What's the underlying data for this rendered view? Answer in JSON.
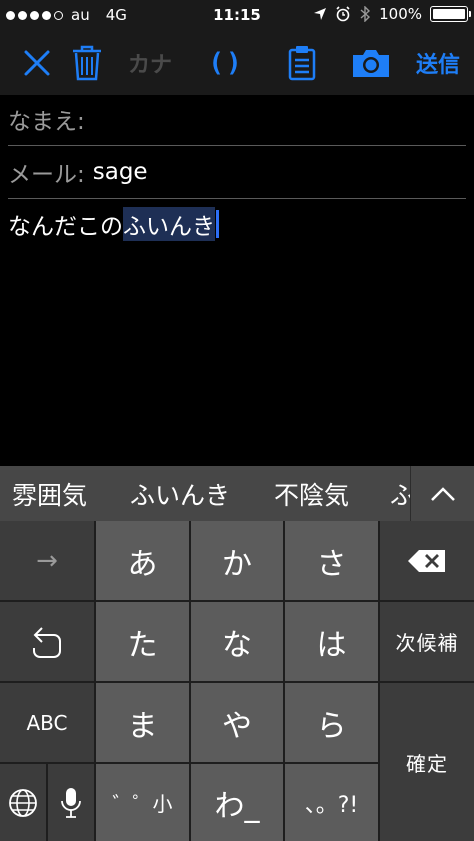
{
  "status_bar": {
    "carrier": "au",
    "network": "4G",
    "time": "11:15",
    "battery": "100%",
    "battery_level": 1.0,
    "signal_bars_filled": 4,
    "signal_bars_total": 5
  },
  "toolbar": {
    "close_icon": "close-icon",
    "trash_icon": "trash-icon",
    "kana_label": "カナ",
    "paren_label": "()",
    "clipboard_icon": "clipboard-icon",
    "camera_icon": "camera-icon",
    "send_label": "送信",
    "accent_color": "#1e7ef7"
  },
  "form": {
    "name_label": "なまえ:",
    "name_value": "",
    "mail_label": "メール:",
    "mail_value": "sage",
    "body_committed": "なんだこの",
    "body_marked": "ふいんき"
  },
  "candidates": {
    "items": [
      "雰囲気",
      "ふいんき",
      "不陰気",
      "ふ"
    ],
    "expand_icon": "chevron-up-icon"
  },
  "keyboard": {
    "arrow_label": "→",
    "keys_row1": [
      "あ",
      "か",
      "さ"
    ],
    "keys_row2": [
      "た",
      "な",
      "は"
    ],
    "keys_row3": [
      "ま",
      "や",
      "ら"
    ],
    "undo_icon": "undo-icon",
    "backspace_icon": "backspace-icon",
    "next_candidate_label": "次候補",
    "abc_label": "ABC",
    "confirm_label": "確定",
    "globe_icon": "globe-icon",
    "mic_icon": "mic-icon",
    "dakuten_label": "゛゜小",
    "wa_label": "わ_",
    "punct_label": "、。?!"
  }
}
